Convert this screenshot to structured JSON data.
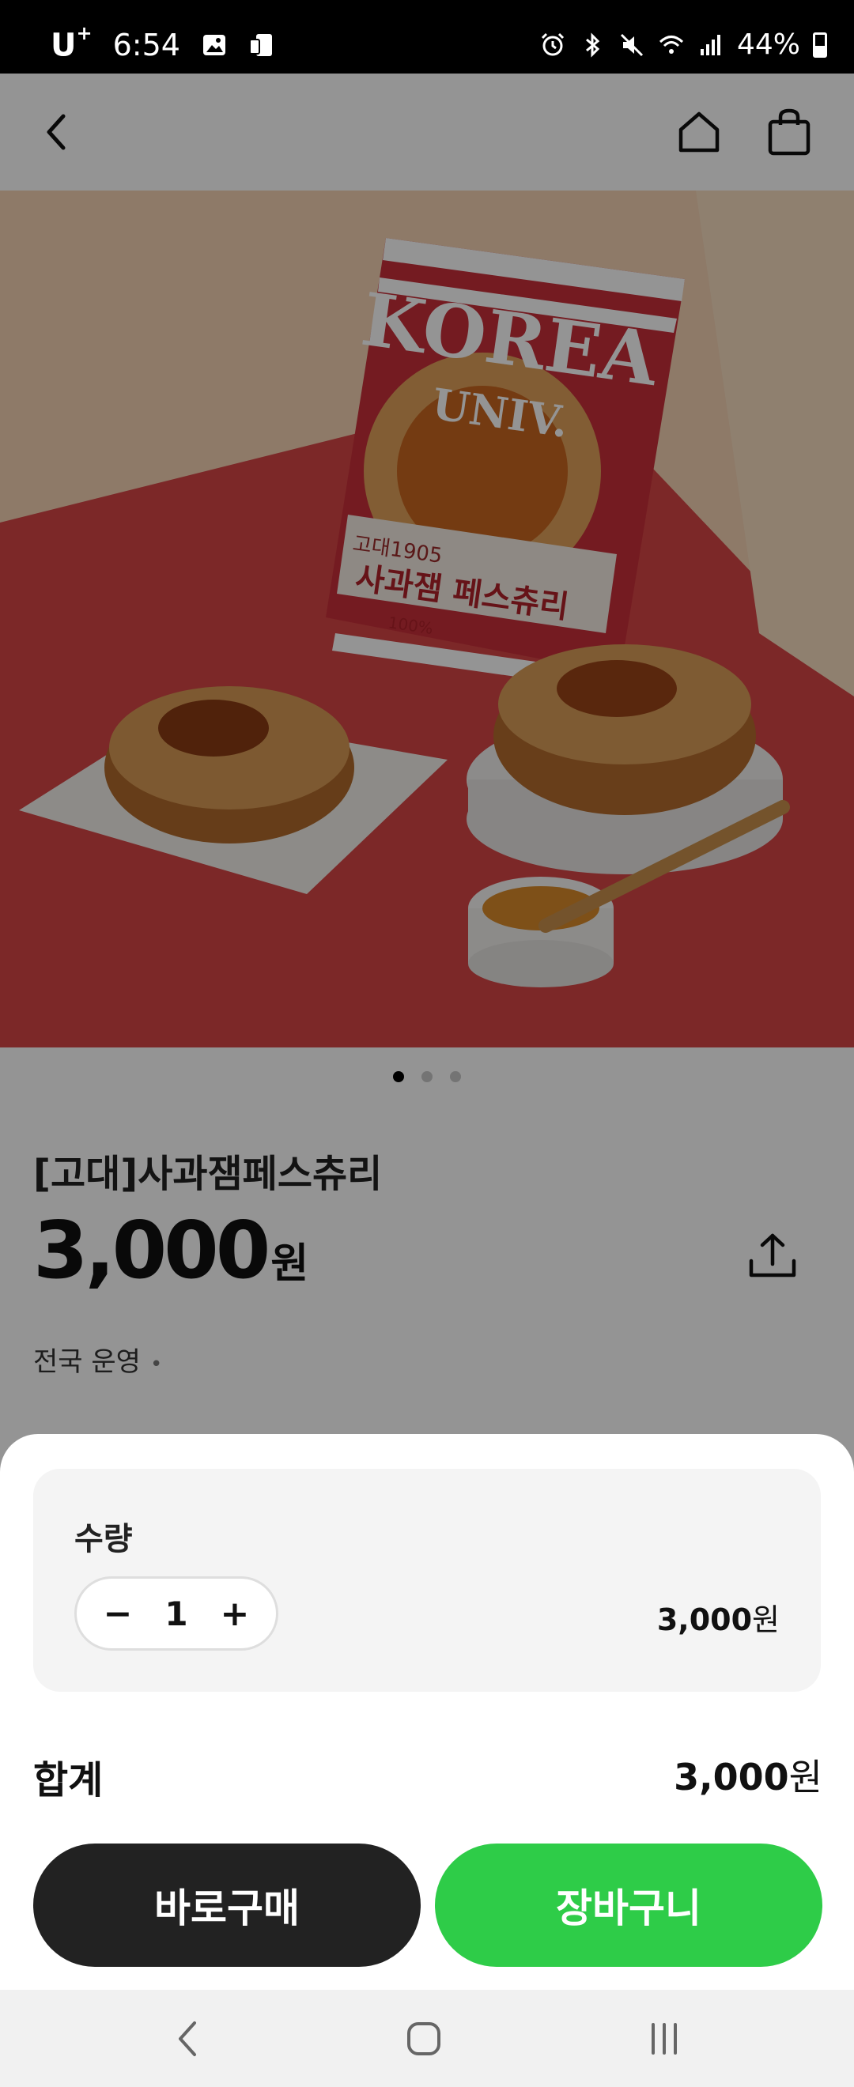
{
  "status_bar": {
    "carrier": "U",
    "carrier_sup": "+",
    "time": "6:54",
    "battery": "44%",
    "icons": [
      "gallery-icon",
      "device-icon",
      "alarm-icon",
      "bluetooth-icon",
      "mute-icon",
      "wifi-icon",
      "signal-icon",
      "battery-icon"
    ]
  },
  "header": {
    "icons": [
      "back-arrow-icon",
      "home-icon",
      "shopping-bag-icon"
    ]
  },
  "hero": {
    "image_text": [
      "KOREA",
      "UNIV.",
      "고대1905",
      "사과잼 페스츄리",
      "100%"
    ],
    "carousel_count": 3,
    "carousel_active": 0
  },
  "product": {
    "title": "[고대]사과잼페스츄리",
    "price": "3,000",
    "price_unit": "원",
    "region": "전국 운영",
    "region_bullet": "•"
  },
  "sheet": {
    "quantity_label": "수량",
    "quantity_value": "1",
    "minus": "−",
    "plus": "+",
    "line_price": "3,000",
    "line_unit": "원",
    "total_label": "합계",
    "total_price": "3,000",
    "total_unit": "원",
    "buy_now_label": "바로구매",
    "cart_label": "장바구니"
  },
  "colors": {
    "cart_button": "#2ecc48",
    "buy_button": "#222222",
    "dim_overlay": "rgba(0,0,0,0.42)"
  }
}
